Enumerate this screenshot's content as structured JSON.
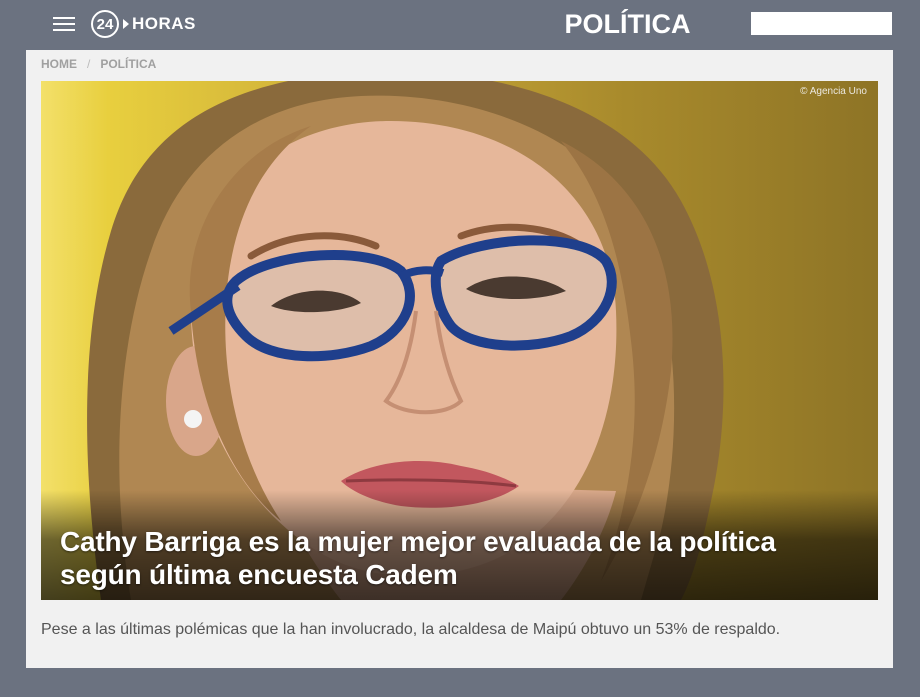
{
  "header": {
    "menu_icon": "hamburger-menu-icon",
    "logo_number": "24",
    "logo_text": "HORAS",
    "section_title": "POLÍTICA",
    "search_placeholder": ""
  },
  "breadcrumb": {
    "items": [
      "HOME",
      "POLÍTICA"
    ],
    "separator": "/"
  },
  "article": {
    "photo_credit": "© Agencia Uno",
    "headline": "Cathy Barriga es la mujer mejor evaluada de la política según última encuesta Cadem",
    "lead": "Pese a las últimas polémicas que la han involucrado, la alcaldesa de Maipú obtuvo un 53% de respaldo."
  },
  "colors": {
    "header_bg": "#6b7280",
    "card_bg": "#f1f1f1",
    "breadcrumb_text": "#a0a0a0",
    "lead_text": "#555555"
  }
}
